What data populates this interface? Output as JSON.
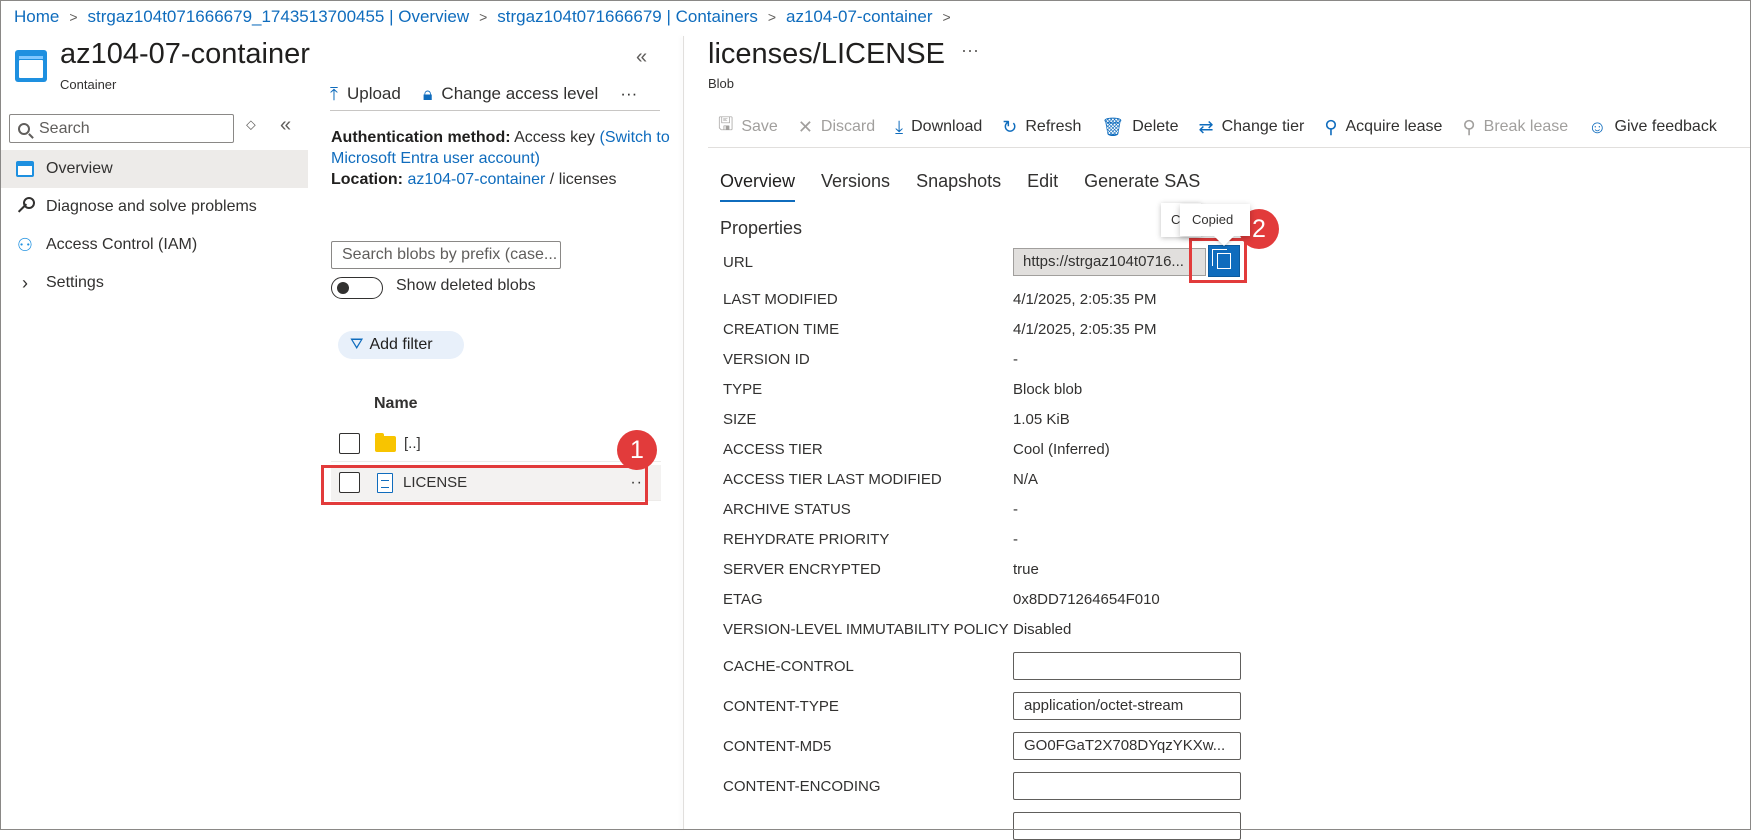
{
  "breadcrumb": {
    "items": [
      "Home",
      "strgaz104t071666679_1743513700455 | Overview",
      "strgaz104t071666679 | Containers",
      "az104-07-container"
    ]
  },
  "left_blade": {
    "title": "az104-07-container",
    "subtitle": "Container",
    "collapse_glyph": "«",
    "search_placeholder": "Search",
    "nav": [
      {
        "label": "Overview",
        "icon": "overview-icon",
        "active": true
      },
      {
        "label": "Diagnose and solve problems",
        "icon": "wrench-icon"
      },
      {
        "label": "Access Control (IAM)",
        "icon": "people-icon"
      },
      {
        "label": "Settings",
        "icon": "chevron-right-icon"
      }
    ]
  },
  "list_panel": {
    "toolbar": {
      "upload": "Upload",
      "change_access": "Change access level",
      "more": "···"
    },
    "auth_label": "Authentication method:",
    "auth_value": "Access key",
    "auth_link": "(Switch to Microsoft Entra user account)",
    "location_label": "Location:",
    "location_link": "az104-07-container",
    "location_sep": "/",
    "location_rest": "licenses",
    "blob_search_placeholder": "Search blobs by prefix (case...",
    "show_deleted": "Show deleted blobs",
    "add_filter": "Add filter",
    "col_name": "Name",
    "rows": [
      {
        "name": "[..]",
        "type": "folder"
      },
      {
        "name": "LICENSE",
        "type": "file",
        "selected": true
      }
    ],
    "row_more": "··"
  },
  "callouts": {
    "one": "1",
    "two": "2"
  },
  "right_blade": {
    "title": "licenses/LICENSE",
    "title_more": "···",
    "subtitle": "Blob",
    "toolbar": [
      {
        "label": "Save",
        "icon": "save-icon",
        "disabled": true
      },
      {
        "label": "Discard",
        "icon": "discard-icon",
        "disabled": true
      },
      {
        "label": "Download",
        "icon": "download-icon"
      },
      {
        "label": "Refresh",
        "icon": "refresh-icon"
      },
      {
        "label": "Delete",
        "icon": "delete-icon"
      },
      {
        "label": "Change tier",
        "icon": "change-tier-icon"
      },
      {
        "label": "Acquire lease",
        "icon": "acquire-lease-icon"
      },
      {
        "label": "Break lease",
        "icon": "break-lease-icon",
        "disabled": true
      },
      {
        "label": "Give feedback",
        "icon": "feedback-icon"
      }
    ],
    "tabs": [
      "Overview",
      "Versions",
      "Snapshots",
      "Edit",
      "Generate SAS"
    ],
    "properties_heading": "Properties",
    "url_label": "URL",
    "url_value": "https://strgaz104t0716...",
    "tooltip_back": "C",
    "tooltip": "Copied",
    "properties": [
      {
        "label": "LAST MODIFIED",
        "value": "4/1/2025, 2:05:35 PM"
      },
      {
        "label": "CREATION TIME",
        "value": "4/1/2025, 2:05:35 PM"
      },
      {
        "label": "VERSION ID",
        "value": "-"
      },
      {
        "label": "TYPE",
        "value": "Block blob"
      },
      {
        "label": "SIZE",
        "value": "1.05 KiB"
      },
      {
        "label": "ACCESS TIER",
        "value": "Cool (Inferred)"
      },
      {
        "label": "ACCESS TIER LAST MODIFIED",
        "value": "N/A"
      },
      {
        "label": "ARCHIVE STATUS",
        "value": "-"
      },
      {
        "label": "REHYDRATE PRIORITY",
        "value": "-"
      },
      {
        "label": "SERVER ENCRYPTED",
        "value": "true"
      },
      {
        "label": "ETAG",
        "value": "0x8DD71264654F010"
      },
      {
        "label": "VERSION-LEVEL IMMUTABILITY POLICY",
        "value": "Disabled"
      }
    ],
    "editable": [
      {
        "label": "CACHE-CONTROL",
        "value": ""
      },
      {
        "label": "CONTENT-TYPE",
        "value": "application/octet-stream"
      },
      {
        "label": "CONTENT-MD5",
        "value": "GO0FGaT2X708DYqzYKXw..."
      },
      {
        "label": "CONTENT-ENCODING",
        "value": ""
      },
      {
        "label": "",
        "value": ""
      }
    ]
  }
}
